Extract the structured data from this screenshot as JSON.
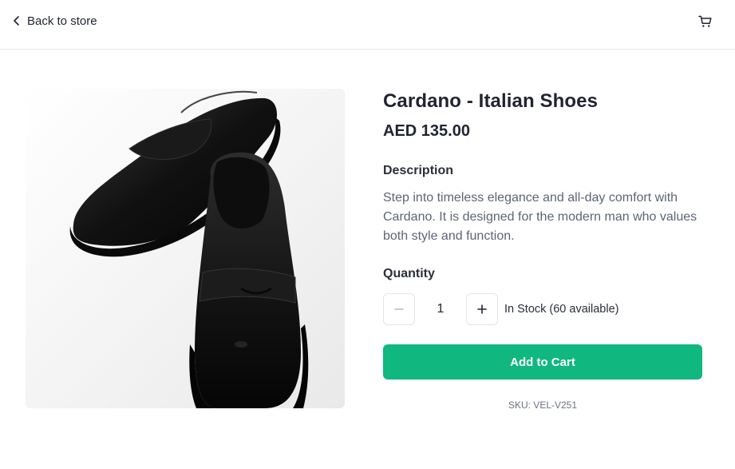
{
  "header": {
    "back_label": "Back to store",
    "back_icon": "chevron-left-icon",
    "cart_icon": "shopping-cart-icon"
  },
  "product": {
    "image_alt": "Black leather penny loafers",
    "title": "Cardano - Italian Shoes",
    "price": "AED 135.00",
    "description_heading": "Description",
    "description": "Step into timeless elegance and all-day comfort with Cardano. It is designed for the modern man who values both style and function.",
    "quantity_heading": "Quantity",
    "quantity": "1",
    "stock": "In Stock (60 available)",
    "add_to_cart_label": "Add to Cart",
    "sku": "SKU: VEL-V251"
  },
  "colors": {
    "accent": "#10b77f",
    "text": "#1f2430",
    "muted": "#5c6577"
  }
}
